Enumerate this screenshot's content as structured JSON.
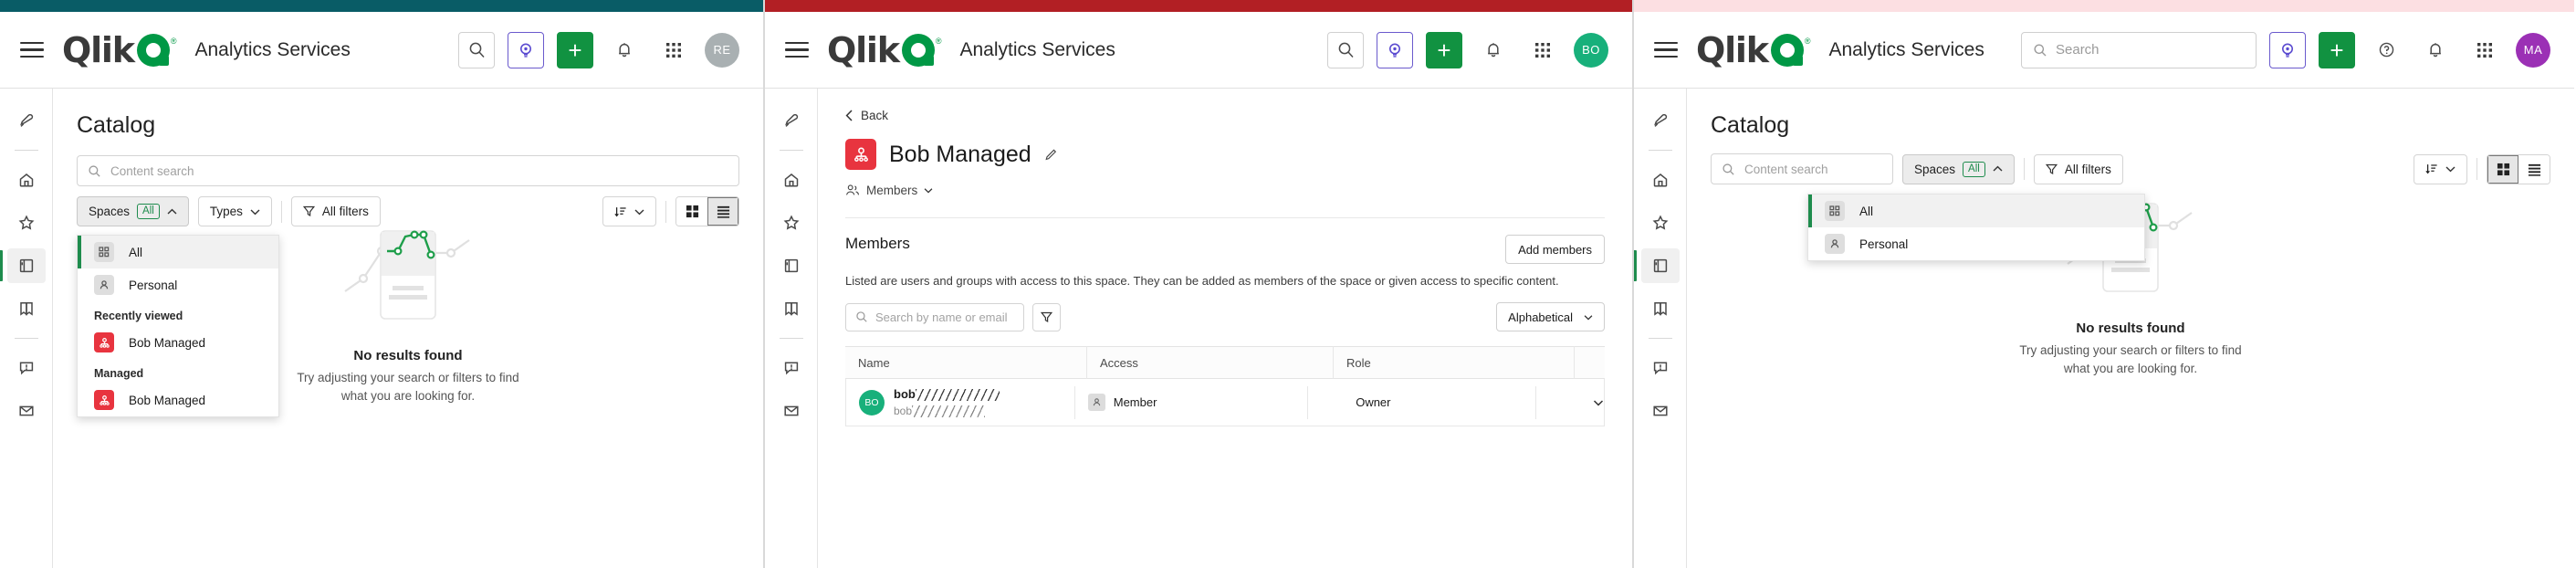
{
  "panels": [
    {
      "id": "panel-catalog-spaces-open",
      "topbar_color": "#095c66",
      "header": {
        "app_title": "Analytics Services",
        "logo_text": "Qlik",
        "logo_reg": "®",
        "avatar_initials": "RE",
        "avatar_color": "#a9b0b2",
        "icons": [
          "menu-icon",
          "search-icon",
          "insight-advisor-icon",
          "add-icon",
          "notifications-icon",
          "apps-grid-icon",
          "avatar"
        ]
      },
      "rail": [
        {
          "name": "rocket-icon",
          "active": false
        },
        {
          "name": "home-icon",
          "active": false
        },
        {
          "name": "star-icon",
          "active": false
        },
        {
          "name": "catalog-icon",
          "active": true
        },
        {
          "name": "bookmark-icon",
          "active": false
        },
        {
          "name": "alerts-icon",
          "active": false
        },
        {
          "name": "mail-icon",
          "active": false
        }
      ],
      "page_title": "Catalog",
      "content_search_placeholder": "Content search",
      "filters": {
        "spaces_label": "Spaces",
        "spaces_pill": "All",
        "types_label": "Types",
        "all_filters_label": "All filters",
        "sort_label": "sort-icon",
        "view": "list"
      },
      "dropdown": {
        "open": true,
        "items": [
          {
            "label": "All",
            "icon": "grid-icon",
            "selected": true,
            "kind": "item"
          },
          {
            "label": "Personal",
            "icon": "person-icon",
            "selected": false,
            "kind": "item"
          },
          {
            "label": "Recently viewed",
            "kind": "group"
          },
          {
            "label": "Bob Managed",
            "icon": "managed-space-icon",
            "selected": false,
            "kind": "item"
          },
          {
            "label": "Managed",
            "kind": "group"
          },
          {
            "label": "Bob Managed",
            "icon": "managed-space-icon",
            "selected": false,
            "kind": "item"
          }
        ]
      },
      "empty_state": {
        "title": "No results found",
        "subtitle": "Try adjusting your search or filters to find what you are looking for."
      }
    },
    {
      "id": "panel-space-members",
      "topbar_color": "#b21f24",
      "header": {
        "app_title": "Analytics Services",
        "logo_text": "Qlik",
        "logo_reg": "®",
        "avatar_initials": "BO",
        "avatar_color": "#18b07b"
      },
      "rail": [
        {
          "name": "rocket-icon",
          "active": false
        },
        {
          "name": "home-icon",
          "active": false
        },
        {
          "name": "star-icon",
          "active": false
        },
        {
          "name": "catalog-icon",
          "active": false
        },
        {
          "name": "bookmark-icon",
          "active": false
        },
        {
          "name": "alerts-icon",
          "active": false
        },
        {
          "name": "mail-icon",
          "active": false
        }
      ],
      "back_label": "Back",
      "space_name": "Bob Managed",
      "tab_label": "Members",
      "members": {
        "heading": "Members",
        "add_button": "Add members",
        "description": "Listed are users and groups with access to this space. They can be added as members of the space or given access to specific content.",
        "search_placeholder": "Search by name or email",
        "sort_value": "Alphabetical",
        "columns": [
          "Name",
          "Access",
          "Role"
        ],
        "rows": [
          {
            "avatar_initials": "BO",
            "name_prefix": "bob",
            "name_redacted": true,
            "email_prefix": "bob",
            "email_redacted": true,
            "access": "Member",
            "role": "Owner"
          }
        ]
      }
    },
    {
      "id": "panel-catalog-empty",
      "topbar_color": "#fcdfe2",
      "header": {
        "app_title": "Analytics Services",
        "logo_text": "Qlik",
        "logo_reg": "®",
        "avatar_initials": "MA",
        "avatar_color": "#9b30b5",
        "search_placeholder": "Search"
      },
      "rail": [
        {
          "name": "rocket-icon",
          "active": false
        },
        {
          "name": "home-icon",
          "active": false
        },
        {
          "name": "star-icon",
          "active": false
        },
        {
          "name": "catalog-icon",
          "active": true
        },
        {
          "name": "bookmark-icon",
          "active": false
        },
        {
          "name": "alerts-icon",
          "active": false
        },
        {
          "name": "mail-icon",
          "active": false
        }
      ],
      "page_title": "Catalog",
      "content_search_placeholder": "Content search",
      "filters": {
        "spaces_label": "Spaces",
        "spaces_pill": "All",
        "all_filters_label": "All filters",
        "view": "grid"
      },
      "dropdown": {
        "open": true,
        "items": [
          {
            "label": "All",
            "icon": "grid-icon",
            "selected": true,
            "kind": "item"
          },
          {
            "label": "Personal",
            "icon": "person-icon",
            "selected": false,
            "kind": "item"
          }
        ]
      },
      "empty_state": {
        "title": "No results found",
        "subtitle": "Try adjusting your search or filters to find what you are looking for."
      }
    }
  ]
}
